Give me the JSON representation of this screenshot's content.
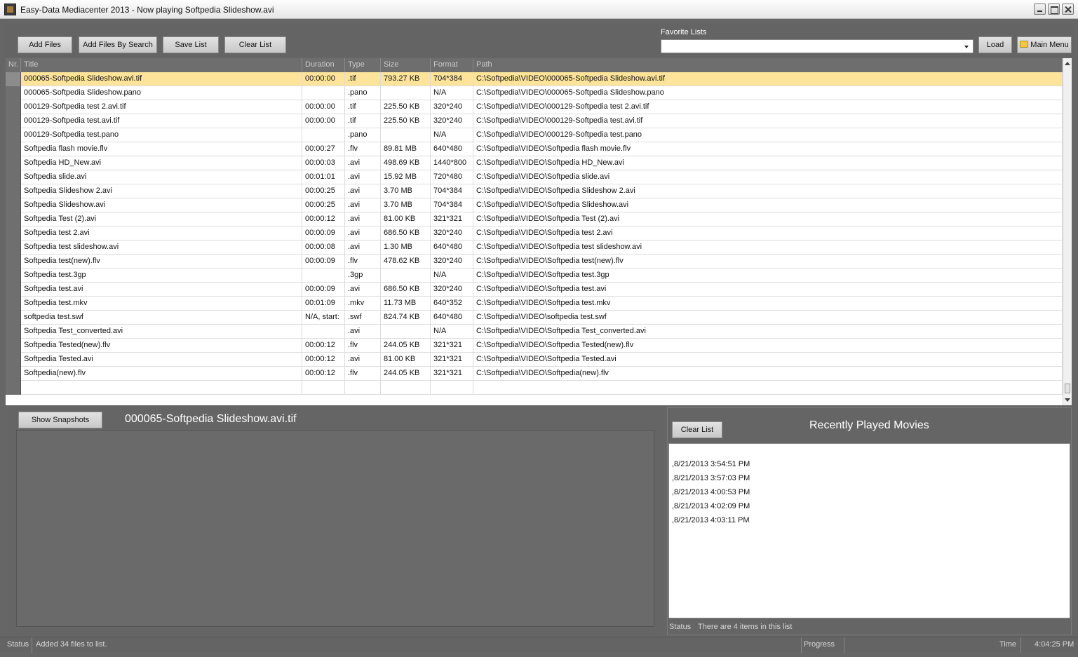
{
  "window": {
    "title": "Easy-Data Mediacenter 2013 - Now playing Softpedia Slideshow.avi"
  },
  "toolbar": {
    "add_files": "Add Files",
    "add_by_search": "Add Files By Search",
    "save_list": "Save List",
    "clear_list": "Clear List",
    "favorites_label": "Favorite Lists",
    "favorites_value": "",
    "load": "Load",
    "main_menu": "Main Menu"
  },
  "table": {
    "columns": [
      "Nr.",
      "Title",
      "Duration",
      "Type",
      "Size",
      "Format",
      "Path"
    ],
    "selected_index": 0,
    "rows": [
      [
        "",
        "000065-Softpedia Slideshow.avi.tif",
        "00:00:00",
        ".tif",
        "793.27 KB",
        "704*384",
        "C:\\Softpedia\\VIDEO\\000065-Softpedia Slideshow.avi.tif"
      ],
      [
        "",
        "000065-Softpedia Slideshow.pano",
        "",
        ".pano",
        "",
        "N/A",
        "C:\\Softpedia\\VIDEO\\000065-Softpedia Slideshow.pano"
      ],
      [
        "",
        "000129-Softpedia test 2.avi.tif",
        "00:00:00",
        ".tif",
        "225.50 KB",
        "320*240",
        "C:\\Softpedia\\VIDEO\\000129-Softpedia test 2.avi.tif"
      ],
      [
        "",
        "000129-Softpedia test.avi.tif",
        "00:00:00",
        ".tif",
        "225.50 KB",
        "320*240",
        "C:\\Softpedia\\VIDEO\\000129-Softpedia test.avi.tif"
      ],
      [
        "",
        "000129-Softpedia test.pano",
        "",
        ".pano",
        "",
        "N/A",
        "C:\\Softpedia\\VIDEO\\000129-Softpedia test.pano"
      ],
      [
        "",
        "Softpedia flash movie.flv",
        "00:00:27",
        ".flv",
        "89.81 MB",
        "640*480",
        "C:\\Softpedia\\VIDEO\\Softpedia flash movie.flv"
      ],
      [
        "",
        "Softpedia HD_New.avi",
        "00:00:03",
        ".avi",
        "498.69 KB",
        "1440*800",
        "C:\\Softpedia\\VIDEO\\Softpedia HD_New.avi"
      ],
      [
        "",
        "Softpedia slide.avi",
        "00:01:01",
        ".avi",
        "15.92 MB",
        "720*480",
        "C:\\Softpedia\\VIDEO\\Softpedia slide.avi"
      ],
      [
        "",
        "Softpedia Slideshow 2.avi",
        "00:00:25",
        ".avi",
        "3.70 MB",
        "704*384",
        "C:\\Softpedia\\VIDEO\\Softpedia Slideshow 2.avi"
      ],
      [
        "",
        "Softpedia Slideshow.avi",
        "00:00:25",
        ".avi",
        "3.70 MB",
        "704*384",
        "C:\\Softpedia\\VIDEO\\Softpedia Slideshow.avi"
      ],
      [
        "",
        "Softpedia Test (2).avi",
        "00:00:12",
        ".avi",
        "81.00 KB",
        "321*321",
        "C:\\Softpedia\\VIDEO\\Softpedia Test (2).avi"
      ],
      [
        "",
        "Softpedia test 2.avi",
        "00:00:09",
        ".avi",
        "686.50 KB",
        "320*240",
        "C:\\Softpedia\\VIDEO\\Softpedia test 2.avi"
      ],
      [
        "",
        "Softpedia test slideshow.avi",
        "00:00:08",
        ".avi",
        "1.30 MB",
        "640*480",
        "C:\\Softpedia\\VIDEO\\Softpedia test slideshow.avi"
      ],
      [
        "",
        "Softpedia test(new).flv",
        "00:00:09",
        ".flv",
        "478.62 KB",
        "320*240",
        "C:\\Softpedia\\VIDEO\\Softpedia test(new).flv"
      ],
      [
        "",
        "Softpedia test.3gp",
        "",
        ".3gp",
        "",
        "N/A",
        "C:\\Softpedia\\VIDEO\\Softpedia test.3gp"
      ],
      [
        "",
        "Softpedia test.avi",
        "00:00:09",
        ".avi",
        "686.50 KB",
        "320*240",
        "C:\\Softpedia\\VIDEO\\Softpedia test.avi"
      ],
      [
        "",
        "Softpedia test.mkv",
        "00:01:09",
        ".mkv",
        "11.73 MB",
        "640*352",
        "C:\\Softpedia\\VIDEO\\Softpedia test.mkv"
      ],
      [
        "",
        "softpedia test.swf",
        "N/A, start:",
        ".swf",
        "824.74 KB",
        "640*480",
        "C:\\Softpedia\\VIDEO\\softpedia test.swf"
      ],
      [
        "",
        "Softpedia Test_converted.avi",
        "",
        ".avi",
        "",
        "N/A",
        "C:\\Softpedia\\VIDEO\\Softpedia Test_converted.avi"
      ],
      [
        "",
        "Softpedia Tested(new).flv",
        "00:00:12",
        ".flv",
        "244.05 KB",
        "321*321",
        "C:\\Softpedia\\VIDEO\\Softpedia Tested(new).flv"
      ],
      [
        "",
        "Softpedia Tested.avi",
        "00:00:12",
        ".avi",
        "81.00 KB",
        "321*321",
        "C:\\Softpedia\\VIDEO\\Softpedia Tested.avi"
      ],
      [
        "",
        "Softpedia(new).flv",
        "00:00:12",
        ".flv",
        "244.05 KB",
        "321*321",
        "C:\\Softpedia\\VIDEO\\Softpedia(new).flv"
      ],
      [
        "",
        "",
        "",
        "",
        "",
        "",
        ""
      ]
    ]
  },
  "preview": {
    "show_snapshots": "Show Snapshots",
    "now_title": "000065-Softpedia Slideshow.avi.tif"
  },
  "recent": {
    "clear_list": "Clear List",
    "title": "Recently Played Movies",
    "items": [
      ",8/21/2013 3:54:51 PM",
      ",8/21/2013 3:57:03 PM",
      ",8/21/2013 4:00:53 PM",
      ",8/21/2013 4:02:09 PM",
      ",8/21/2013 4:03:11 PM"
    ],
    "status_label": "Status",
    "status_text": "There are 4 items in this list"
  },
  "statusbar": {
    "status_label": "Status",
    "status_text": "Added 34 files to list.",
    "progress_label": "Progress",
    "time_label": "Time",
    "time_value": "4:04:25 PM"
  }
}
